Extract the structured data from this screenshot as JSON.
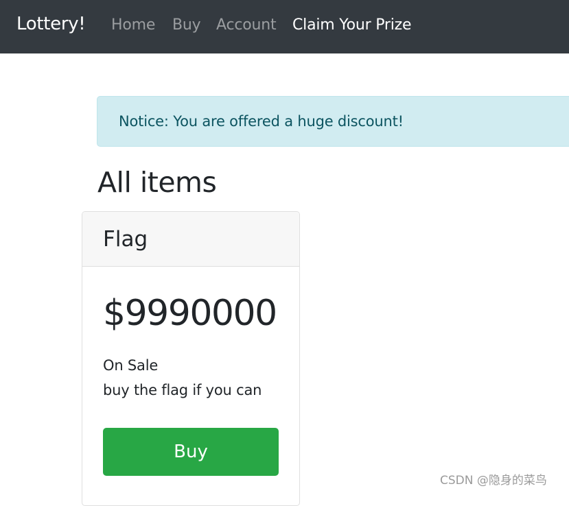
{
  "navbar": {
    "brand": "Lottery!",
    "links": [
      "Home",
      "Buy",
      "Account",
      "Claim Your Prize"
    ],
    "active_link": "Claim Your Prize"
  },
  "alert": {
    "text": "Notice: You are offered a huge discount!"
  },
  "main": {
    "title": "All items",
    "items": [
      {
        "name": "Flag",
        "price": "$9990000",
        "status": "On Sale",
        "description": "buy the flag if you can",
        "button_label": "Buy"
      }
    ]
  },
  "watermark": "CSDN @隐身的菜鸟",
  "colors": {
    "navbar_bg": "#343a40",
    "alert_bg": "#d1ecf1",
    "alert_text": "#0c5460",
    "buy_button": "#28a745"
  }
}
